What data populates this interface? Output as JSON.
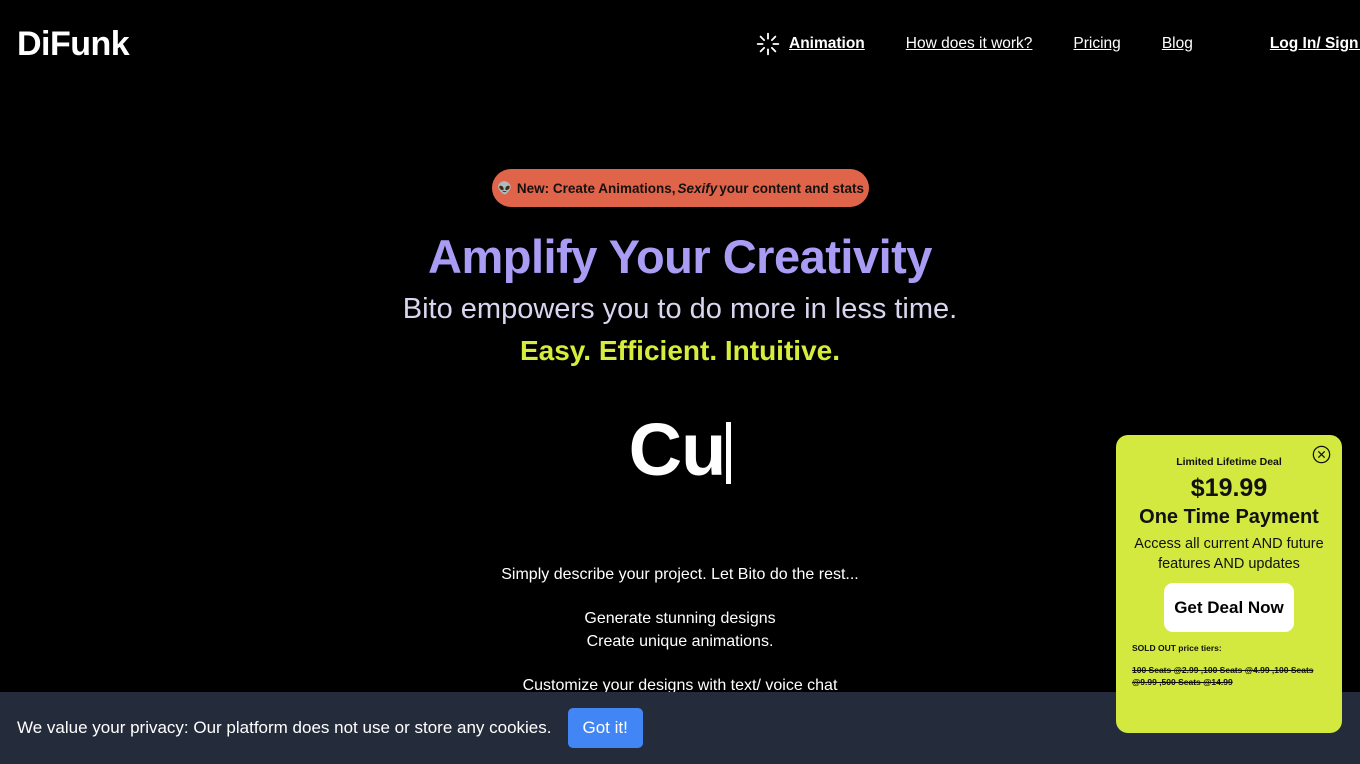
{
  "brand": {
    "logo": "DiFunk"
  },
  "nav": {
    "items": [
      {
        "label": "Animation",
        "icon": "sparkle-icon",
        "bold": true
      },
      {
        "label": "How does it work?",
        "bold": false
      },
      {
        "label": "Pricing",
        "bold": false
      },
      {
        "label": "Blog",
        "bold": false
      },
      {
        "label": "Log In/ Sign Up",
        "bold": true
      }
    ]
  },
  "announcement": {
    "emoji": "👽",
    "text_before": "New: Create Animations,",
    "emphasis": "Sexify",
    "text_after": "your content and stats",
    "background": "#e0644a",
    "text_color": "#14110f"
  },
  "hero": {
    "title": "Amplify Your Creativity",
    "title_color": "#a99cf5",
    "subtitle": "Bito empowers you to do more in less time.",
    "tagline": "Easy. Efficient. Intuitive.",
    "tagline_color": "#d6ed3c"
  },
  "typing": {
    "text": "Cu",
    "caret": "|"
  },
  "copy": {
    "line1": "Simply describe your project. Let Bito do the rest...",
    "line2": "Generate stunning designs",
    "line3": "Create unique animations.",
    "line4": "Customize your designs with text/ voice chat"
  },
  "promo": {
    "kicker": "Limited Lifetime Deal",
    "price": "$19.99",
    "headline": "One Time Payment",
    "description": "Access all current AND future features AND updates",
    "cta": "Get Deal Now",
    "soldout_label": "SOLD OUT price tiers:",
    "tiers": "100 Seats @2.99  ,100 Seats @4.99  ,100 Seats @9.99  ,500 Seats @14.99",
    "background": "#d3e93f",
    "close_icon": "close-circle-icon"
  },
  "cookie": {
    "message": "We value your privacy: Our platform does not use or store any cookies.",
    "button": "Got it!",
    "button_color": "#4285f4",
    "background": "#242c3b"
  }
}
